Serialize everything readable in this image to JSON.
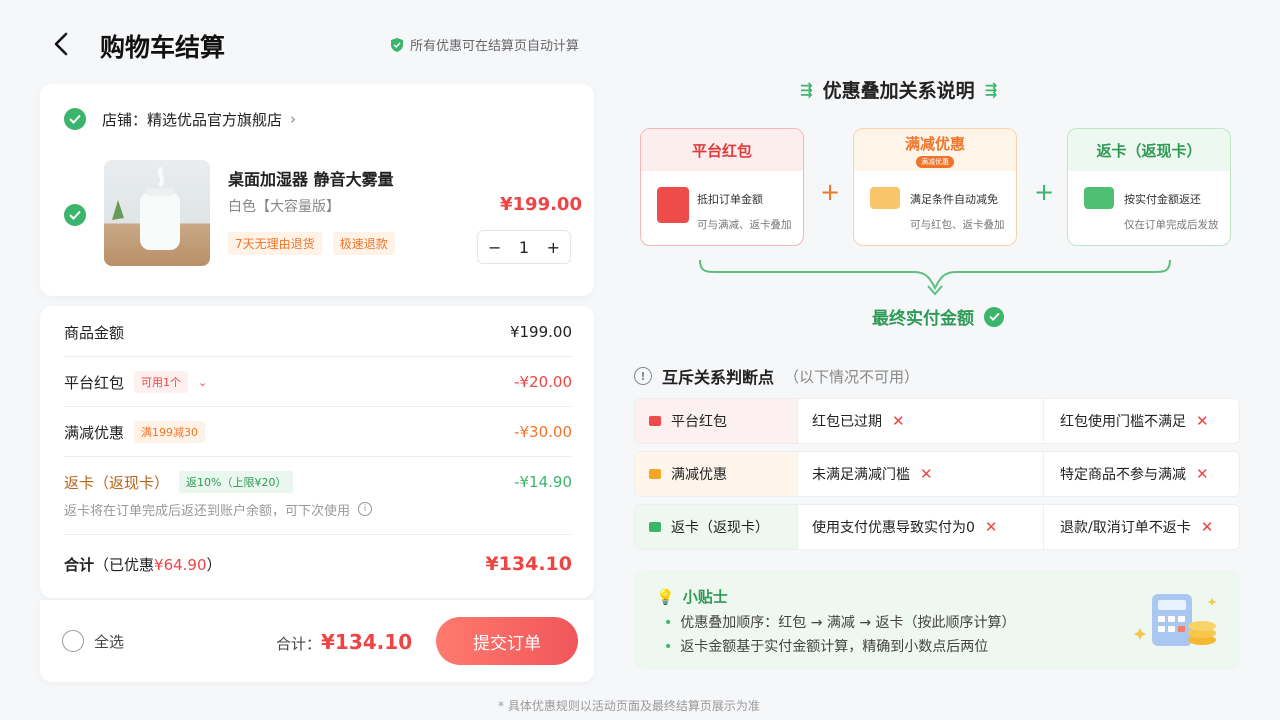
{
  "header": {
    "title": "购物车结算",
    "notice": "所有优惠可在结算页自动计算"
  },
  "shop": {
    "name": "店铺：精选优品官方旗舰店",
    "chevron": "›"
  },
  "product": {
    "name": "桌面加湿器 静音大雾量",
    "spec": "白色【大容量版】",
    "tags": [
      "7天无理由退货",
      "极速退款"
    ],
    "price": "¥199.00",
    "quantity": "1",
    "minus": "−",
    "plus": "+"
  },
  "summary": {
    "goods_label": "商品金额",
    "goods_value": "¥199.00",
    "redpacket_label": "平台红包",
    "redpacket_pill": "可用1个",
    "redpacket_value": "-¥20.00",
    "fullcut_label": "满减优惠",
    "fullcut_pill": "满199减30",
    "fullcut_value": "-¥30.00",
    "cashback_label": "返卡（返现卡）",
    "cashback_pill": "返10%（上限¥20）",
    "cashback_value": "-¥14.90",
    "cashback_note": "返卡将在订单完成后返还到账户余额，可下次使用",
    "total_label": "合计",
    "total_discount_prefix": "（已优惠",
    "total_discount_value": "¥64.90",
    "total_discount_suffix": "）",
    "total_value": "¥134.10"
  },
  "footer": {
    "select_all": "全选",
    "total_label": "合计：",
    "total_value": "¥134.10",
    "submit": "提交订单"
  },
  "relations": {
    "title": "优惠叠加关系说明",
    "boxes": [
      {
        "title": "平台红包",
        "line1": "抵扣订单金额",
        "line2": "可与满减、返卡叠加"
      },
      {
        "title": "满减优惠",
        "badge": "满减优惠",
        "line1": "满足条件自动减免",
        "line2": "可与红包、返卡叠加"
      },
      {
        "title": "返卡（返现卡）",
        "line1": "按实付金额返还",
        "line2": "仅在订单完成后发放"
      }
    ],
    "plus": "+",
    "final": "最终实付金额"
  },
  "exclusions": {
    "title": "互斥关系判断点",
    "subtitle": "（以下情况不可用）",
    "rows": [
      {
        "name": "平台红包",
        "c2": "红包已过期",
        "c3": "红包使用门槛不满足"
      },
      {
        "name": "满减优惠",
        "c2": "未满足满减门槛",
        "c3": "特定商品不参与满减"
      },
      {
        "name": "返卡（返现卡）",
        "c2": "使用支付优惠导致实付为0",
        "c3": "退款/取消订单不返卡"
      }
    ],
    "x": "✕"
  },
  "tips": {
    "title": "小贴士",
    "items": [
      "优惠叠加顺序：红包 → 满减 → 返卡（按此顺序计算）",
      "返卡金额基于实付金额计算，精确到小数点后两位"
    ]
  },
  "bottom_note": "* 具体优惠规则以活动页面及最终结算页展示为准",
  "colors": {
    "red": "#f04444",
    "orange": "#f0752a",
    "green": "#3bb56b"
  }
}
